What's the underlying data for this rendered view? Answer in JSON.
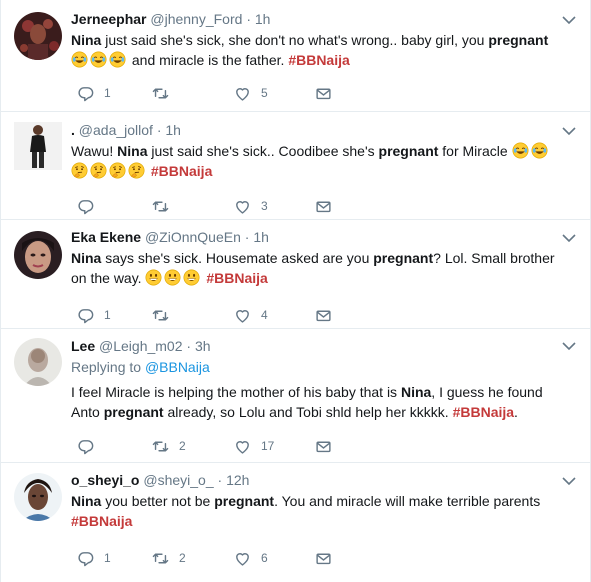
{
  "tweets": [
    {
      "name": "Jerneephar",
      "handle": "@jhenny_Ford",
      "dot": "·",
      "time": "1h",
      "segments": [
        {
          "text": "Nina",
          "bold": true
        },
        {
          "text": " just said she's sick, she don't no what's wrong..  baby girl, you "
        },
        {
          "text": "pregnant",
          "bold": true
        },
        {
          "text": " "
        },
        {
          "emoji": "joy"
        },
        {
          "emoji": "joy"
        },
        {
          "emoji": "joy"
        },
        {
          "text": " and miracle is the father. "
        },
        {
          "text": "#BBNaija",
          "tag": true
        }
      ],
      "reply_count": "1",
      "retweet_count": "",
      "like_count": "5"
    },
    {
      "name": ".",
      "handle": "@ada_jollof",
      "dot": "·",
      "time": "1h",
      "segments": [
        {
          "text": "Wawu! "
        },
        {
          "text": "Nina",
          "bold": true
        },
        {
          "text": " just said she's sick.. Coodibee she's "
        },
        {
          "text": "pregnant",
          "bold": true
        },
        {
          "text": " for Miracle "
        },
        {
          "emoji": "joy"
        },
        {
          "emoji": "joy"
        },
        {
          "emoji": "thinking"
        },
        {
          "emoji": "thinking"
        },
        {
          "emoji": "thinking"
        },
        {
          "emoji": "thinking"
        },
        {
          "text": " "
        },
        {
          "text": "#BBNaija",
          "tag": true
        }
      ],
      "reply_count": "",
      "retweet_count": "",
      "like_count": "3"
    },
    {
      "name": "Eka Ekene",
      "handle": "@ZiOnnQueEn",
      "dot": "·",
      "time": "1h",
      "segments": [
        {
          "text": "Nina",
          "bold": true
        },
        {
          "text": " says she's sick. Housemate asked are you "
        },
        {
          "text": "pregnant",
          "bold": true
        },
        {
          "text": "? Lol. Small brother on the way. "
        },
        {
          "emoji": "grin"
        },
        {
          "emoji": "grin"
        },
        {
          "emoji": "grin"
        },
        {
          "text": " "
        },
        {
          "text": "#BBNaija",
          "tag": true
        }
      ],
      "reply_count": "1",
      "retweet_count": "",
      "like_count": "4"
    },
    {
      "name": "Lee",
      "handle": "@Leigh_m02",
      "dot": "·",
      "time": "3h",
      "replying_label": "Replying to",
      "replying_to": "@BBNaija",
      "segments": [
        {
          "text": "I feel Miracle is helping the mother of his baby that is "
        },
        {
          "text": "Nina",
          "bold": true
        },
        {
          "text": ", I guess he found Anto "
        },
        {
          "text": "pregnant",
          "bold": true
        },
        {
          "text": " already, so Lolu and Tobi shld help her kkkkk. "
        },
        {
          "text": "#BBNaija",
          "tag": true
        },
        {
          "text": "."
        }
      ],
      "reply_count": "",
      "retweet_count": "2",
      "like_count": "17"
    },
    {
      "name": "o_sheyi_o",
      "handle": "@sheyi_o_",
      "dot": "·",
      "time": "12h",
      "segments": [
        {
          "text": "Nina",
          "bold": true
        },
        {
          "text": " you better not be "
        },
        {
          "text": "pregnant",
          "bold": true
        },
        {
          "text": ". You and miracle will make terrible parents "
        },
        {
          "text": "#BBNaija",
          "tag": true
        }
      ],
      "reply_count": "1",
      "retweet_count": "2",
      "like_count": "6"
    }
  ],
  "colors": {
    "text": "#14171a",
    "secondary": "#657786",
    "hashtag": "#c43a3a",
    "link": "#1b95e0",
    "divider": "#e6ecf0"
  },
  "icons": {
    "reply": "reply-icon",
    "retweet": "retweet-icon",
    "like": "heart-icon",
    "message": "direct-message-icon",
    "menu": "chevron-down-icon"
  }
}
